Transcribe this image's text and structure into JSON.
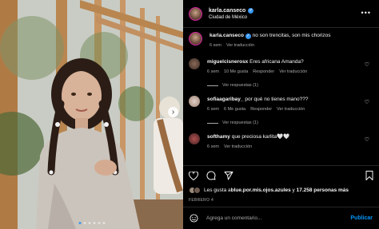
{
  "post": {
    "username": "karla.canseco",
    "location": "Ciudad de México",
    "caption": "no son trencitas, son mis chorizos",
    "caption_time": "6 sem",
    "see_translation": "Ver traducción"
  },
  "comments": [
    {
      "user": "miguelcisnerosx",
      "text": "Eres africana Amanda?",
      "time": "6 sem",
      "likes": "10 Me gusta",
      "reply": "Responder",
      "translate": "Ver traducción",
      "replies": "Ver respuestas (1)"
    },
    {
      "user": "sofiaagaribay_",
      "text": "por qué no tienes mano???",
      "time": "6 sem",
      "likes": "6 Me gusta",
      "reply": "Responder",
      "translate": "Ver traducción",
      "replies": "Ver respuestas (1)"
    },
    {
      "user": "softhamy",
      "text": "que preciosa karlita🤍🤍",
      "time": "6 sem",
      "likes": "",
      "reply": "",
      "translate": "Ver traducción",
      "replies": ""
    }
  ],
  "likes_text": {
    "prefix": "Les gusta a ",
    "user": "blue.por.mis.ojos.azules",
    "mid": " y ",
    "count": "17.258 personas más"
  },
  "date": "FEBRERO 4",
  "add_comment": {
    "placeholder": "Agrega un comentario...",
    "post": "Publicar"
  },
  "colors": {
    "accent": "#0095f6",
    "verified": "#3897f0",
    "muted": "#a8a8a8"
  },
  "icons": [
    "heart-icon",
    "comment-icon",
    "share-icon",
    "bookmark-icon",
    "emoji-icon",
    "more-icon"
  ]
}
